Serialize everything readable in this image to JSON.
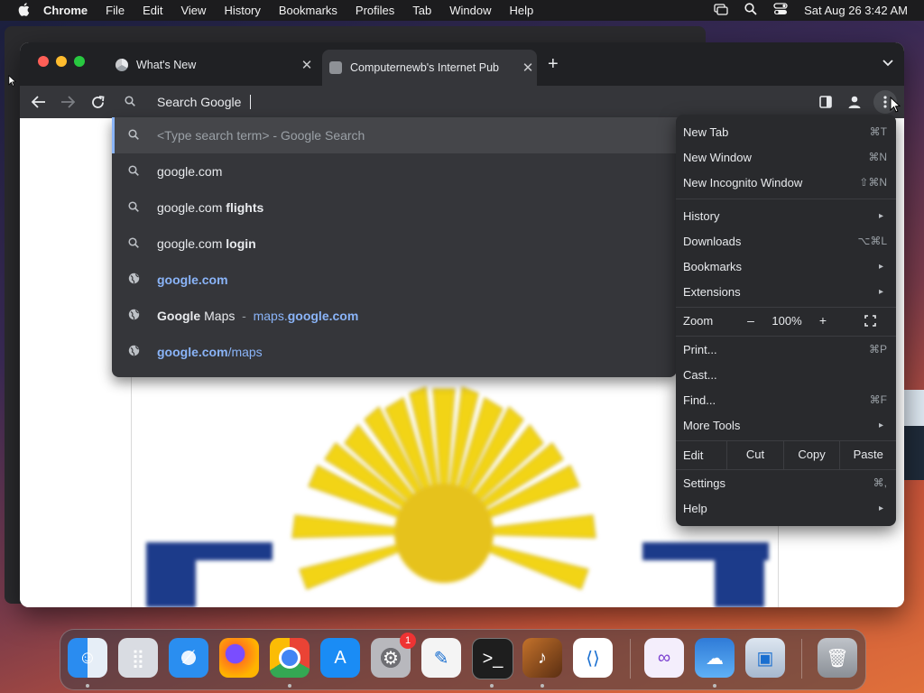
{
  "menubar": {
    "app": "Chrome",
    "items": [
      "File",
      "Edit",
      "View",
      "History",
      "Bookmarks",
      "Profiles",
      "Tab",
      "Window",
      "Help"
    ],
    "clock": "Sat Aug 26  3:42 AM"
  },
  "tabs": [
    {
      "title": "What's New",
      "active": false
    },
    {
      "title": "Computernewb's Internet Pub",
      "active": true
    }
  ],
  "omnibox": {
    "text": "Search Google"
  },
  "suggestions": [
    {
      "icon": "search-icon",
      "parts": [
        {
          "t": "<Type search term> - Google Search",
          "s": "muted"
        }
      ]
    },
    {
      "icon": "search-icon",
      "parts": [
        {
          "t": "google.com",
          "s": ""
        }
      ]
    },
    {
      "icon": "search-icon",
      "parts": [
        {
          "t": "google.com ",
          "s": ""
        },
        {
          "t": "flights",
          "s": "b"
        }
      ]
    },
    {
      "icon": "search-icon",
      "parts": [
        {
          "t": "google.com ",
          "s": ""
        },
        {
          "t": "login",
          "s": "b"
        }
      ]
    },
    {
      "icon": "globe-icon",
      "parts": [
        {
          "t": "google.com",
          "s": "link b"
        }
      ]
    },
    {
      "icon": "globe-icon",
      "parts": [
        {
          "t": "Google",
          "s": "b"
        },
        {
          "t": " Maps",
          "s": ""
        },
        {
          "t": "  -  ",
          "s": "muted"
        },
        {
          "t": "maps.",
          "s": "link"
        },
        {
          "t": "google.com",
          "s": "link b"
        }
      ]
    },
    {
      "icon": "globe-icon",
      "parts": [
        {
          "t": "google.com",
          "s": "link b"
        },
        {
          "t": "/maps",
          "s": "link"
        }
      ]
    }
  ],
  "menu": {
    "items": [
      {
        "label": "New Tab",
        "shortcut": "⌘T"
      },
      {
        "label": "New Window",
        "shortcut": "⌘N"
      },
      {
        "label": "New Incognito Window",
        "shortcut": "⇧⌘N"
      },
      {
        "label": "History",
        "submenu": true
      },
      {
        "label": "Downloads",
        "shortcut": "⌥⌘L"
      },
      {
        "label": "Bookmarks",
        "submenu": true
      },
      {
        "label": "Extensions",
        "submenu": true
      },
      {
        "label": "Print...",
        "shortcut": "⌘P"
      },
      {
        "label": "Cast..."
      },
      {
        "label": "Find...",
        "shortcut": "⌘F"
      },
      {
        "label": "More Tools",
        "submenu": true
      },
      {
        "label": "Settings",
        "shortcut": "⌘,"
      },
      {
        "label": "Help",
        "submenu": true
      }
    ],
    "zoom": {
      "label": "Zoom",
      "minus": "–",
      "value": "100%",
      "plus": "+"
    },
    "edit": {
      "label": "Edit",
      "cut": "Cut",
      "copy": "Copy",
      "paste": "Paste"
    }
  },
  "dock": {
    "apps": [
      "finder",
      "launchpad",
      "safari",
      "firefox",
      "chrome",
      "app-store",
      "system-settings",
      "textedit",
      "terminal",
      "garageband",
      "vscode",
      "visual-studio",
      "weather",
      "preview",
      "trash"
    ],
    "settings_badge": "1"
  },
  "colors": {
    "accent": "#8ab4f8",
    "menu_bg": "#292a2d",
    "toolbar_bg": "#35363a"
  }
}
